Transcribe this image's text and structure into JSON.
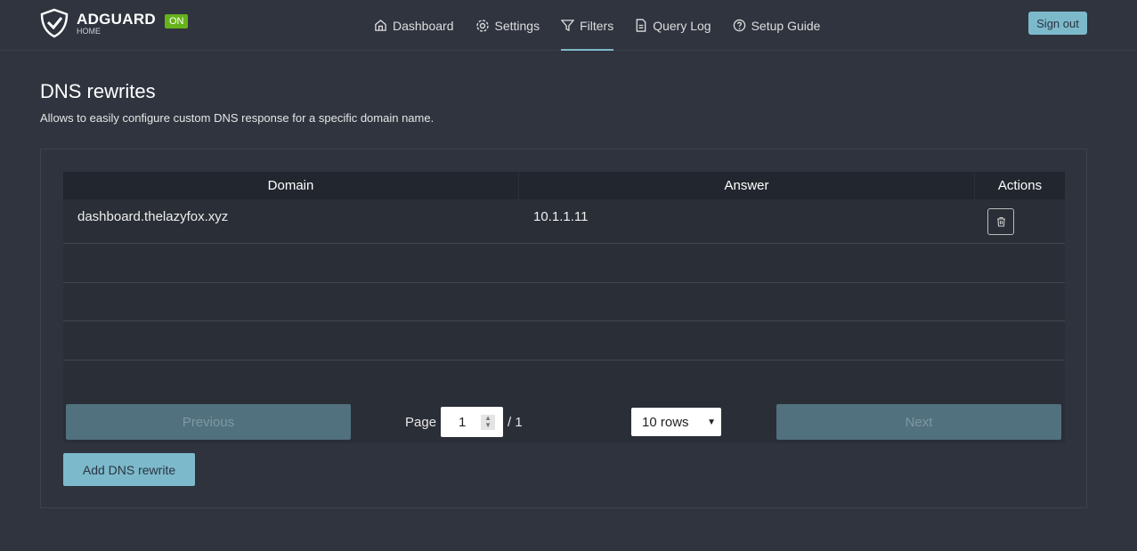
{
  "header": {
    "brand": "ADGUARD",
    "brand_sub": "HOME",
    "status_badge": "ON",
    "sign_out": "Sign out",
    "nav": [
      {
        "label": "Dashboard",
        "icon": "home-icon"
      },
      {
        "label": "Settings",
        "icon": "gear-icon"
      },
      {
        "label": "Filters",
        "icon": "filter-icon",
        "active": true
      },
      {
        "label": "Query Log",
        "icon": "document-icon"
      },
      {
        "label": "Setup Guide",
        "icon": "help-circle-icon"
      }
    ]
  },
  "page": {
    "title": "DNS rewrites",
    "subtitle": "Allows to easily configure custom DNS response for a specific domain name."
  },
  "table": {
    "columns": [
      "Domain",
      "Answer",
      "Actions"
    ],
    "rows": [
      {
        "domain": "dashboard.thelazyfox.xyz",
        "answer": "10.1.1.11"
      }
    ]
  },
  "pagination": {
    "previous": "Previous",
    "next": "Next",
    "page_label": "Page",
    "page_value": "1",
    "total": "/ 1",
    "rows_option": "10 rows"
  },
  "add_button": "Add DNS rewrite",
  "colors": {
    "accent": "#7cb9cb",
    "on_badge": "#67b21b",
    "background": "#2f343f"
  }
}
